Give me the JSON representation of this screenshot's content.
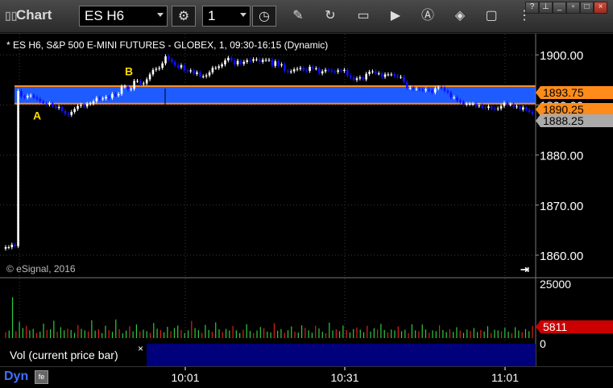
{
  "toolbar": {
    "app_title": "Chart",
    "symbol": "ES H6",
    "interval": "1"
  },
  "chart": {
    "header": "* ES H6, S&P 500 E-MINI FUTURES - GLOBEX, 1, 09:30-16:15 (Dynamic)",
    "copyright": "© eSignal, 2016",
    "label_a": "A",
    "label_b": "B",
    "price_labels": [
      "1893.75",
      "1890.25",
      "1888.25"
    ],
    "volume_label": "5811",
    "volume_panel_title": "Vol (current price bar)",
    "volume_close_glyph": "×",
    "status_text": "Dyn",
    "colors": {
      "up_candle": "#ffffff",
      "down_candle": "#1010ff",
      "highlight_band": "#1e5cff",
      "level_line": "#ff8c1a",
      "volume_up": "#2ecc40",
      "volume_down": "#e0201a",
      "status_blue": "#00007a"
    }
  },
  "chart_data": [
    {
      "type": "candlestick",
      "title": "* ES H6, S&P 500 E-MINI FUTURES - GLOBEX, 1, 09:30-16:15 (Dynamic)",
      "y_ticks": [
        1900,
        1890,
        1880,
        1870,
        1860
      ],
      "y_tick_labels": [
        "1900.00",
        "1890.00",
        "1880.00",
        "1870.00",
        "1860.00"
      ],
      "ylim": [
        1855.5,
        1904.2
      ],
      "x_ticks": [
        "10:01",
        "10:31",
        "11:01"
      ],
      "grid": true,
      "horizontal_levels": [
        {
          "price": 1893.75,
          "color": "#ff8c1a"
        },
        {
          "price": 1890.25,
          "color": "#ff8c1a"
        }
      ],
      "band": {
        "from": 1890.25,
        "to": 1893.75,
        "color": "#1e5cff"
      },
      "current_price": 1888.25,
      "annotations": [
        {
          "text": "A",
          "price": 1889.0
        },
        {
          "text": "B",
          "price": 1895.3
        }
      ],
      "closes": [
        1861.6,
        1861.6,
        1862.1,
        1861.8,
        1892.8,
        1891.7,
        1891.5,
        1891.8,
        1891.9,
        1891.5,
        1891.2,
        1890.7,
        1890.3,
        1890.1,
        1890.3,
        1889.8,
        1889.4,
        1889.6,
        1888.8,
        1888.2,
        1888.0,
        1888.6,
        1889.2,
        1889.8,
        1890.0,
        1889.7,
        1890.2,
        1890.3,
        1890.7,
        1891.4,
        1891.2,
        1891.3,
        1891.6,
        1891.4,
        1892.2,
        1891.9,
        1892.2,
        1893.7,
        1893.7,
        1893.1,
        1893.2,
        1894.8,
        1894.8,
        1894.2,
        1894.3,
        1895.1,
        1896.1,
        1897.0,
        1897.2,
        1897.4,
        1898.3,
        1899.7,
        1899.1,
        1898.6,
        1897.9,
        1897.5,
        1897.9,
        1896.9,
        1896.7,
        1896.9,
        1896.2,
        1896.5,
        1895.7,
        1895.7,
        1895.9,
        1896.5,
        1897.4,
        1897.4,
        1897.7,
        1898.1,
        1898.9,
        1899.4,
        1898.9,
        1898.1,
        1898.8,
        1898.2,
        1898.6,
        1898.9,
        1898.8,
        1899.1,
        1899.1,
        1898.6,
        1899.0,
        1899.0,
        1899.0,
        1897.8,
        1898.7,
        1897.9,
        1898.1,
        1896.8,
        1896.6,
        1896.7,
        1897.1,
        1897.2,
        1897.4,
        1896.9,
        1896.8,
        1897.6,
        1897.3,
        1897.3,
        1896.3,
        1896.7,
        1897.0,
        1896.9,
        1896.7,
        1896.6,
        1896.9,
        1896.8,
        1897.0,
        1895.9,
        1895.5,
        1895.0,
        1895.3,
        1895.5,
        1895.1,
        1896.2,
        1896.6,
        1896.7,
        1896.3,
        1896.3,
        1895.6,
        1896.1,
        1896.1,
        1896.1,
        1895.8,
        1895.6,
        1895.6,
        1894.6,
        1893.4,
        1893.4,
        1893.2,
        1893.2,
        1893.1,
        1892.9,
        1893.1,
        1892.9,
        1892.5,
        1893.3,
        1893.5,
        1893.4,
        1892.8,
        1892.5,
        1891.5,
        1891.5,
        1890.9,
        1890.6,
        1890.1,
        1890.2,
        1890.2,
        1890.2,
        1889.8,
        1889.9,
        1889.5,
        1889.4,
        1889.7,
        1889.3,
        1889.2,
        1889.3,
        1889.8,
        1890.4,
        1890.1,
        1890.1,
        1889.6,
        1889.7,
        1889.1,
        1889.5,
        1889.0,
        1888.6,
        1888.2
      ]
    },
    {
      "type": "bar",
      "title": "Vol (current price bar)",
      "y_ticks": [
        25000,
        0
      ],
      "y_tick_labels": [
        "25000",
        "0"
      ],
      "ylim": [
        0,
        25000
      ],
      "current_value": 5811,
      "values": [
        2800,
        3600,
        19500,
        3300,
        7800,
        4800,
        5800,
        3700,
        4400,
        2500,
        3100,
        6900,
        3900,
        4200,
        8300,
        3000,
        5200,
        3700,
        4500,
        3900,
        2500,
        6200,
        4400,
        3700,
        3100,
        8500,
        3600,
        4300,
        2400,
        5900,
        3800,
        3000,
        8900,
        4300,
        2300,
        3600,
        5700,
        3200,
        6500,
        3100,
        4000,
        3300,
        2500,
        7200,
        4500,
        3800,
        2800,
        5400,
        3300,
        4800,
        6000,
        3900,
        2400,
        3700,
        8200,
        4800,
        3800,
        2500,
        6300,
        3900,
        3000,
        7500,
        4200,
        2800,
        4400,
        3600,
        5800,
        3700,
        2400,
        4000,
        6600,
        3400,
        2400,
        3600,
        5300,
        4700,
        3100,
        2700,
        7100,
        3500,
        4300,
        2500,
        3800,
        5600,
        3100,
        2600,
        6100,
        4900,
        3700,
        2600,
        5900,
        4600,
        3000,
        2300,
        7400,
        3700,
        4200,
        3300,
        6000,
        3800,
        2700,
        4300,
        5100,
        4000,
        2800,
        5900,
        3100,
        4700,
        4100,
        6800,
        3900,
        2700,
        4100,
        3700,
        5600,
        3300,
        4000,
        2300,
        6600,
        3700,
        3300,
        6500,
        4100,
        2500,
        3700,
        3300,
        6100,
        3900,
        2900,
        4300,
        3000,
        5200,
        3600,
        2500,
        4100,
        3400,
        4800,
        2900,
        3900,
        3200,
        5700,
        2400,
        4000,
        3700,
        3200,
        4900,
        3100,
        2300,
        5200,
        3600,
        2900,
        4300,
        3300,
        5811
      ]
    }
  ]
}
